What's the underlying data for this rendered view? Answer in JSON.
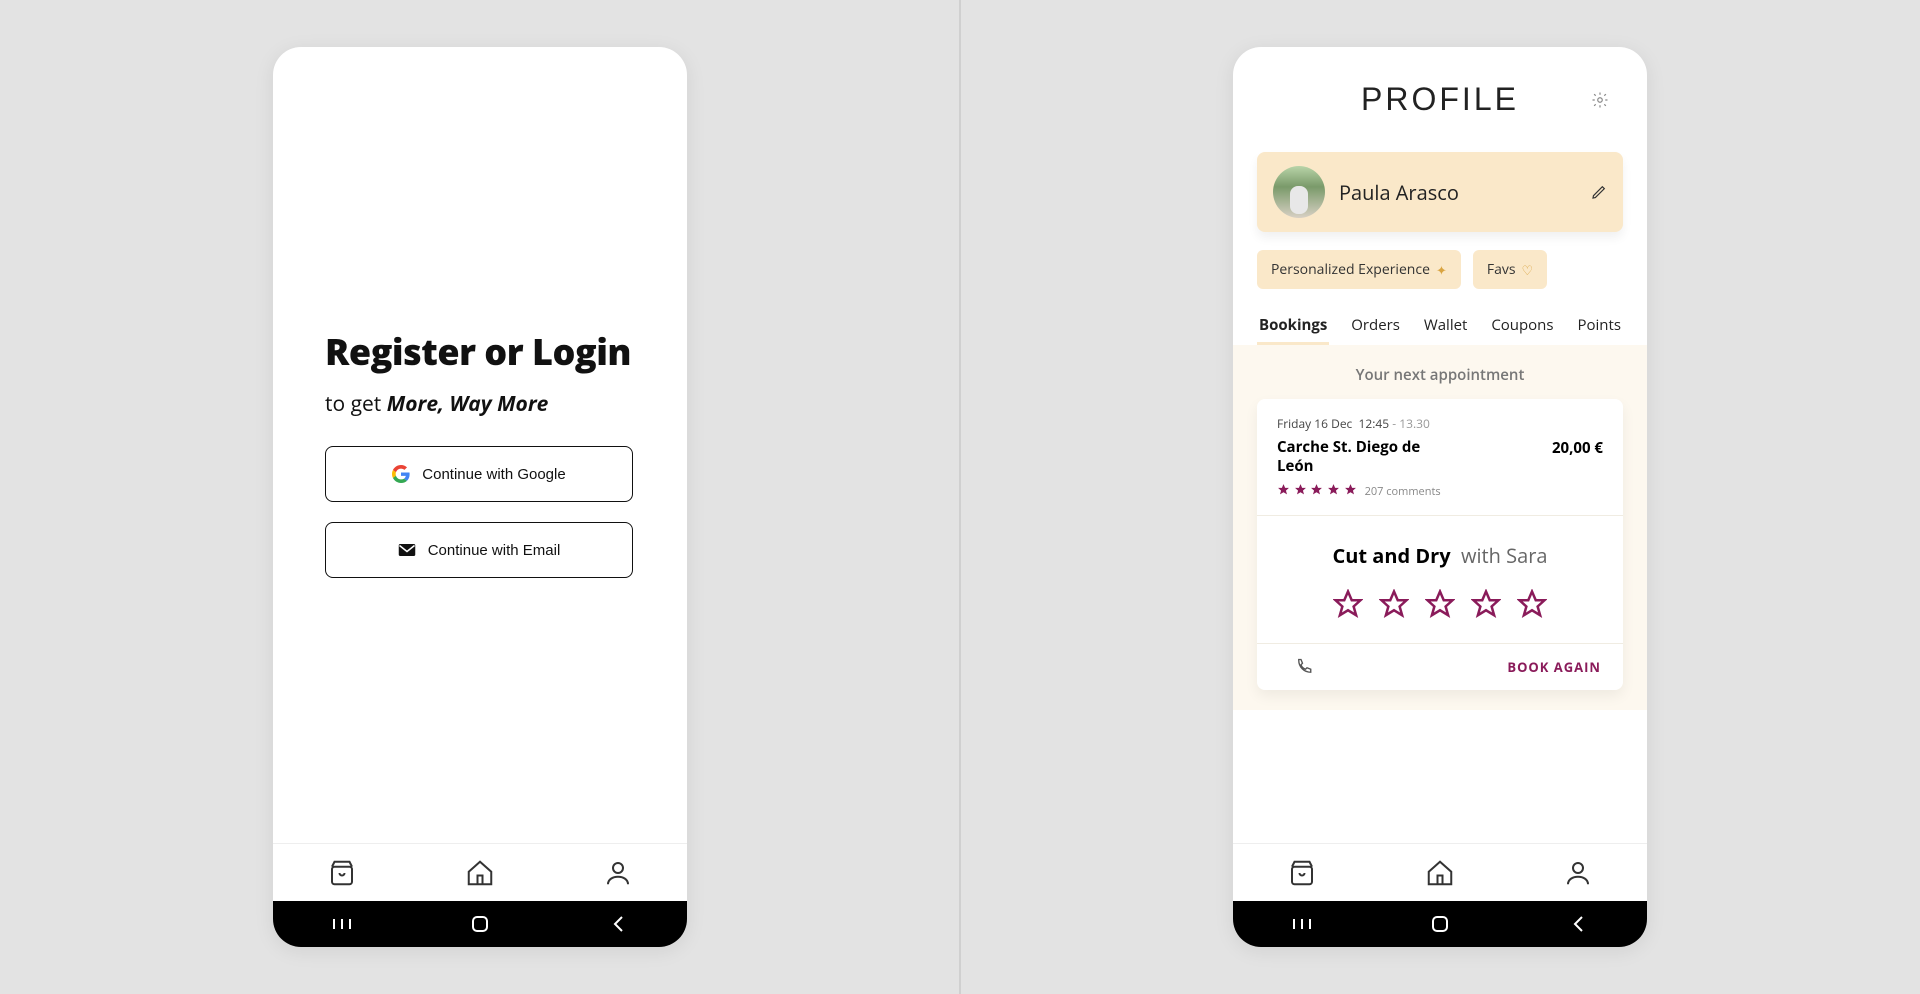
{
  "login": {
    "title": "Register or Login",
    "subtitle_prefix": "to get ",
    "subtitle_em": "More, Way More",
    "google_label": "Continue with Google",
    "email_label": "Continue with Email"
  },
  "profile": {
    "header": "PROFILE",
    "user_name": "Paula Arasco",
    "chips": {
      "personalized": "Personalized Experience",
      "favs": "Favs"
    },
    "tabs": [
      "Bookings",
      "Orders",
      "Wallet",
      "Coupons",
      "Points"
    ],
    "active_tab_index": 0,
    "next_appointment_label": "Your next appointment",
    "booking": {
      "date_prefix": "Friday 16 Dec",
      "time_start": "12:45",
      "time_end": "13.30",
      "place": "Carche St. Diego de León",
      "price": "20,00 €",
      "rating": 5,
      "comments_label": "207 comments",
      "service": "Cut and Dry",
      "with_label": "with Sara",
      "book_again": "BOOK AGAIN"
    }
  },
  "colors": {
    "accent_cream": "#fae8c9",
    "brand_magenta": "#8a1b5a"
  }
}
